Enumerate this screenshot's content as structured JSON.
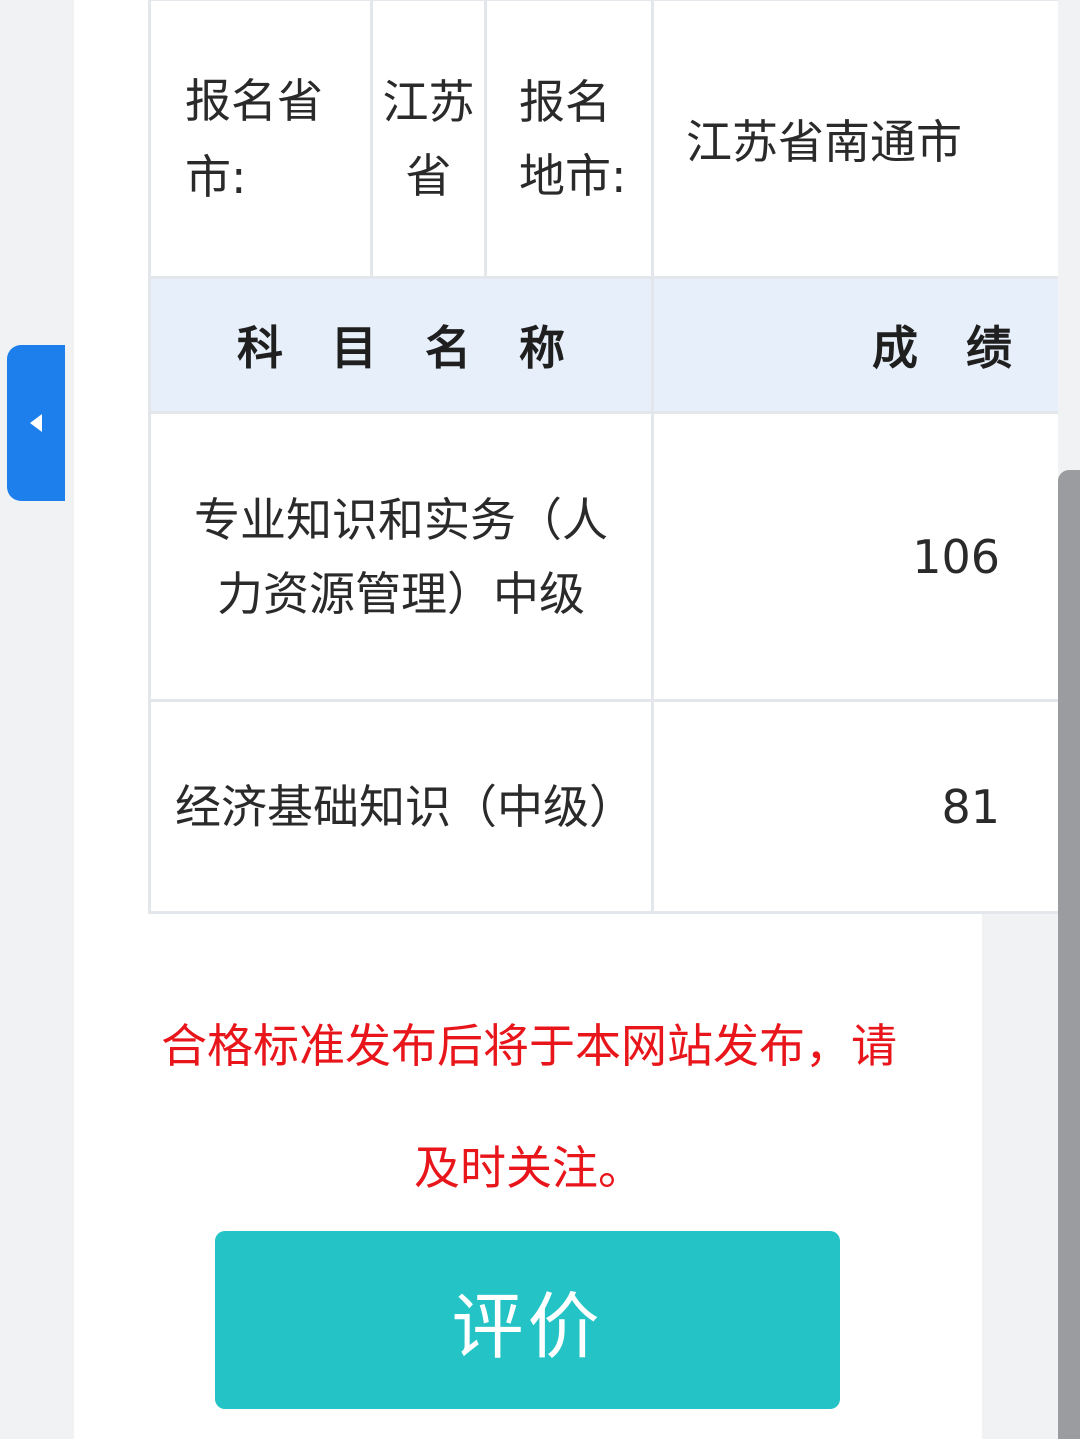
{
  "table": {
    "location_row": {
      "province_label": "报名省市:",
      "province_value": "江苏省",
      "city_label": "报名地市:",
      "city_value": "江苏省南通市"
    },
    "headers": {
      "subject": "科目名称",
      "score": "成绩"
    },
    "rows": [
      {
        "subject": "专业知识和实务（人力资源管理）中级",
        "score": "106"
      },
      {
        "subject": "经济基础知识（中级）",
        "score": "81"
      }
    ]
  },
  "notice": {
    "text": "合格标准发布后将于本网站发布，请及时关注。",
    "color": "#e8151b"
  },
  "evaluate_button": {
    "label": "评价",
    "color": "#24c3c6"
  },
  "side_tab": {
    "icon": "chevron-left-icon",
    "color": "#1d7fec"
  }
}
